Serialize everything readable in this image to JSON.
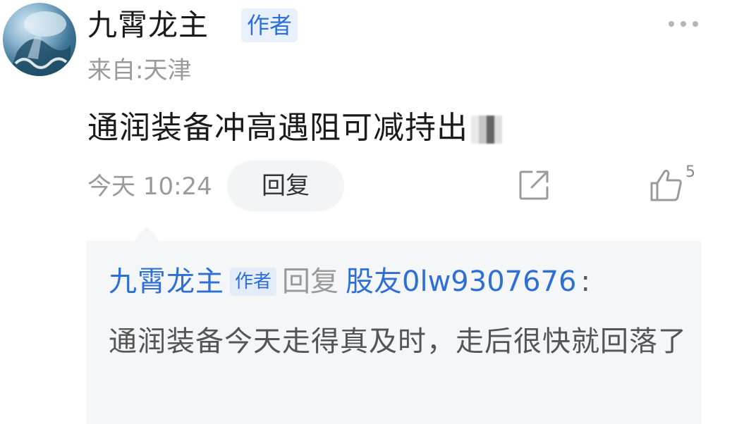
{
  "post": {
    "author_name": "九霄龙主",
    "author_badge": "作者",
    "location": "来自:天津",
    "content": "通润装备冲高遇阻可减持出",
    "time": "今天 10:24",
    "reply_label": "回复",
    "like_count": "5"
  },
  "reply": {
    "author_name": "九霄龙主",
    "author_badge": "作者",
    "reply_word": "回复",
    "target_user": "股友0lw9307676",
    "colon": ":",
    "content": "通润装备今天走得真及时，走后很快就回落了"
  },
  "icons": {
    "more": "more-dots-icon",
    "share": "share-icon",
    "like": "thumb-up-icon"
  },
  "colors": {
    "link_blue": "#2d6fd6",
    "muted_gray": "#9a9a9a",
    "reply_bg": "#f5f6f8"
  }
}
